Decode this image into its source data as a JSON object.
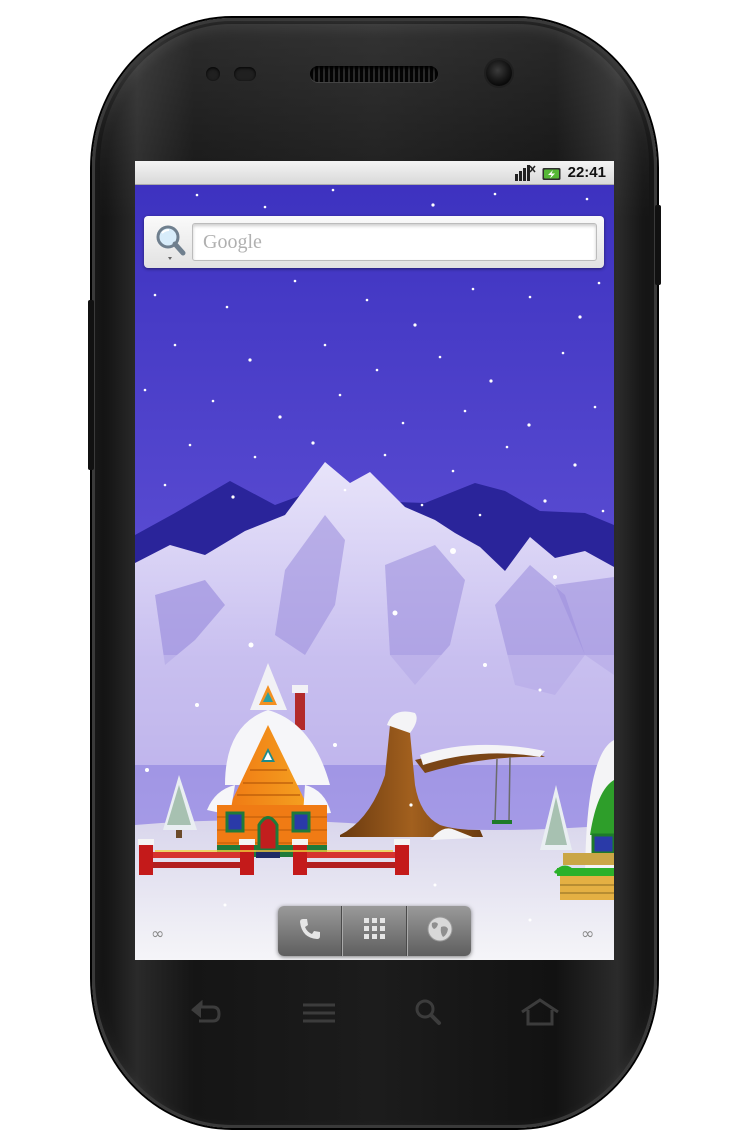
{
  "status_bar": {
    "time": "22:41",
    "icons": [
      "signal-icon",
      "battery-charging-icon"
    ]
  },
  "search_widget": {
    "placeholder": "Google",
    "icons": [
      "magnifier-icon"
    ]
  },
  "dock": {
    "items": [
      {
        "name": "phone-icon"
      },
      {
        "name": "app-drawer-icon"
      },
      {
        "name": "browser-globe-icon"
      }
    ]
  },
  "page_indicators": {
    "left": "∞",
    "right": "∞"
  },
  "hardware_keys": [
    "back-icon",
    "menu-icon",
    "search-icon",
    "home-icon"
  ],
  "wallpaper": {
    "theme": "winter-village-live-wallpaper",
    "colors": {
      "sky_top": "#3b2fbe",
      "sky_bottom": "#7f72dc",
      "mountain_dark": "#2a2498",
      "mountain_light": "#b6a9e8",
      "snow": "#f2f2f6"
    }
  }
}
